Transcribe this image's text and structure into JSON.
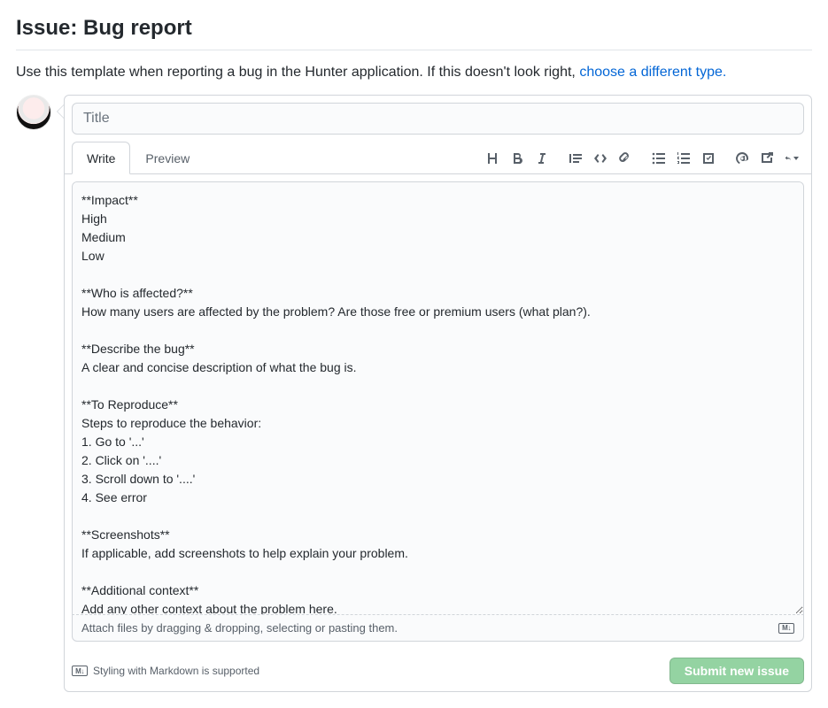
{
  "header": {
    "title": "Issue: Bug report",
    "subtitle_prefix": "Use this template when reporting a bug in the Hunter application. If this doesn't look right, ",
    "subtitle_link": "choose a different type."
  },
  "title_input": {
    "placeholder": "Title",
    "value": ""
  },
  "tabs": {
    "write": "Write",
    "preview": "Preview"
  },
  "toolbar_icons": {
    "heading": "heading",
    "bold": "bold",
    "italic": "italic",
    "quote": "quote",
    "code": "code",
    "link": "link",
    "ul": "bulleted-list",
    "ol": "numbered-list",
    "tasklist": "task-list",
    "mention": "mention",
    "crossref": "cross-reference",
    "reply": "reply"
  },
  "body": {
    "value": "**Impact**\nHigh\nMedium\nLow\n\n**Who is affected?**\nHow many users are affected by the problem? Are those free or premium users (what plan?).\n\n**Describe the bug**\nA clear and concise description of what the bug is.\n\n**To Reproduce**\nSteps to reproduce the behavior:\n1. Go to '...'\n2. Click on '....'\n3. Scroll down to '....'\n4. See error\n\n**Screenshots**\nIf applicable, add screenshots to help explain your problem.\n\n**Additional context**\nAdd any other context about the problem here."
  },
  "attach_hint": "Attach files by dragging & dropping, selecting or pasting them.",
  "md_help": "Styling with Markdown is supported",
  "submit_label": "Submit new issue",
  "md_badge_text": "M↓"
}
